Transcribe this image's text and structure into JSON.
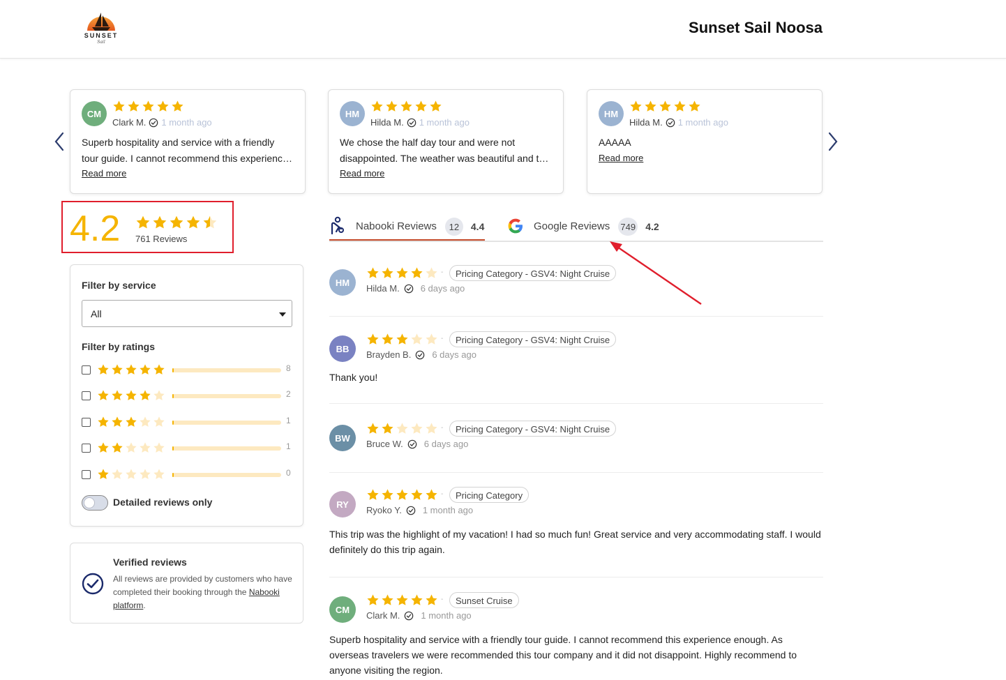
{
  "header": {
    "logo_text": "SUNSET",
    "logo_sub": "Sail",
    "title": "Sunset Sail Noosa"
  },
  "colors": {
    "star": "#f5b400",
    "star_empty": "#fde9c0",
    "accent_red": "#e01e2c",
    "tab_active": "#c44a2a",
    "navy": "#1b2a6b"
  },
  "carousel": {
    "cards": [
      {
        "initials": "CM",
        "avatar_color": "#6fae7c",
        "name": "Clark M.",
        "ago": "1 month ago",
        "rating": 5,
        "text": "Superb hospitality and service with a friendly tour guide. I cannot recommend this experience enough.",
        "more": "Read more"
      },
      {
        "initials": "HM",
        "avatar_color": "#9bb3d1",
        "name": "Hilda M.",
        "ago": "1 month ago",
        "rating": 5,
        "text": "We chose the half day tour and were not disappointed. The weather was beautiful and the crew was fantastic.",
        "more": "Read more"
      },
      {
        "initials": "HM",
        "avatar_color": "#9bb3d1",
        "name": "Hilda M.",
        "ago": "1 month ago",
        "rating": 5,
        "text": "AAAAA",
        "more": "Read more"
      }
    ]
  },
  "summary": {
    "score": "4.2",
    "rating": 4.2,
    "count_label": "761 Reviews"
  },
  "filters": {
    "service_title": "Filter by service",
    "service_value": "All",
    "ratings_title": "Filter by ratings",
    "rows": [
      {
        "stars": 5,
        "count": "8",
        "fill": 0.0
      },
      {
        "stars": 4,
        "count": "2",
        "fill": 0.0
      },
      {
        "stars": 3,
        "count": "1",
        "fill": 0.0
      },
      {
        "stars": 2,
        "count": "1",
        "fill": 0.0
      },
      {
        "stars": 1,
        "count": "0",
        "fill": 0.0
      }
    ],
    "detailed_label": "Detailed reviews only"
  },
  "verified": {
    "title": "Verified reviews",
    "text": "All reviews are provided by customers who have completed their booking through the",
    "link": "Nabooki platform",
    "after": "."
  },
  "tabs": [
    {
      "label": "Nabooki Reviews",
      "count": "12",
      "score": "4.4",
      "icon": "nabooki-icon",
      "active": true
    },
    {
      "label": "Google Reviews",
      "count": "749",
      "score": "4.2",
      "icon": "google-icon",
      "active": false
    }
  ],
  "reviews": [
    {
      "initials": "HM",
      "avatar_color": "#9bb3d1",
      "rating": 4,
      "dash": "-",
      "category": "Pricing Category - GSV4: Night Cruise",
      "name": "Hilda M.",
      "ago": "6 days ago",
      "text": ""
    },
    {
      "initials": "BB",
      "avatar_color": "#7a82c2",
      "rating": 3,
      "dash": "-",
      "category": "Pricing Category - GSV4: Night Cruise",
      "name": "Brayden B.",
      "ago": "6 days ago",
      "text": "Thank you!"
    },
    {
      "initials": "BW",
      "avatar_color": "#6b8fa6",
      "rating": 2,
      "dash": "-",
      "category": "Pricing Category - GSV4: Night Cruise",
      "name": "Bruce W.",
      "ago": "6 days ago",
      "text": ""
    },
    {
      "initials": "RY",
      "avatar_color": "#c3a9c2",
      "rating": 5,
      "dash": "-",
      "category": "Pricing Category",
      "name": "Ryoko Y.",
      "ago": "1 month ago",
      "text": "This trip was the highlight of my vacation! I had so much fun! Great service and very accommodating staff. I would definitely do this trip again."
    },
    {
      "initials": "CM",
      "avatar_color": "#6fae7c",
      "rating": 5,
      "dash": "-",
      "category": "Sunset Cruise",
      "name": "Clark M.",
      "ago": "1 month ago",
      "text": "Superb hospitality and service with a friendly tour guide. I cannot recommend this experience enough. As overseas travelers we were recommended this tour company and it did not disappoint. Highly recommend to anyone visiting the region."
    }
  ]
}
